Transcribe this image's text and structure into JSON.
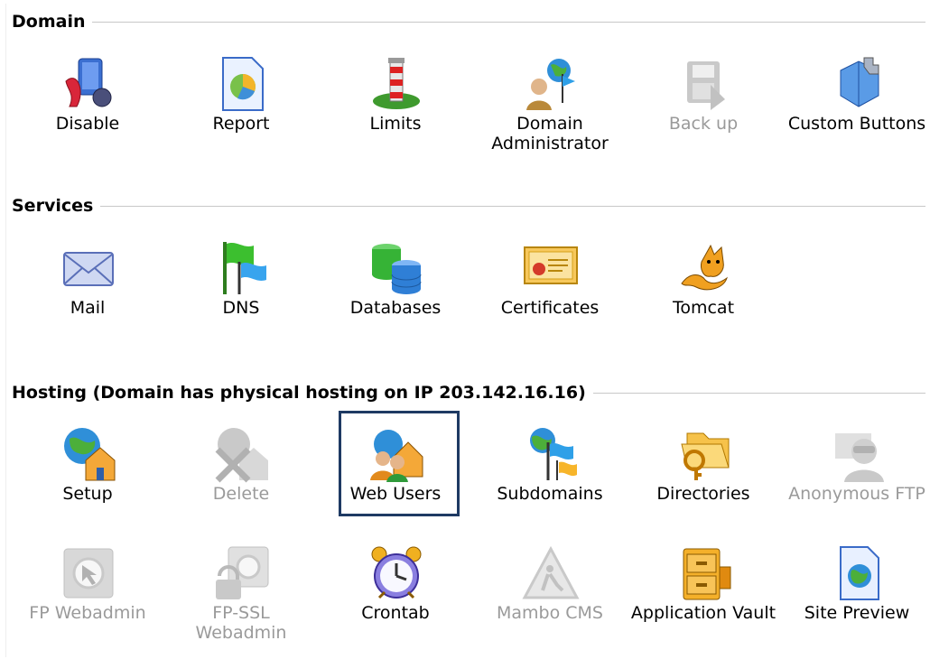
{
  "sections": {
    "domain": {
      "title": "Domain",
      "items": [
        {
          "label": "Disable",
          "icon": "disable-icon",
          "enabled": true
        },
        {
          "label": "Report",
          "icon": "report-icon",
          "enabled": true
        },
        {
          "label": "Limits",
          "icon": "limits-icon",
          "enabled": true
        },
        {
          "label": "Domain\nAdministrator",
          "icon": "domain-administrator-icon",
          "enabled": true
        },
        {
          "label": "Back up",
          "icon": "backup-icon",
          "enabled": false
        },
        {
          "label": "Custom Buttons",
          "icon": "custom-buttons-icon",
          "enabled": true
        }
      ]
    },
    "services": {
      "title": "Services",
      "items": [
        {
          "label": "Mail",
          "icon": "mail-icon",
          "enabled": true
        },
        {
          "label": "DNS",
          "icon": "dns-icon",
          "enabled": true
        },
        {
          "label": "Databases",
          "icon": "databases-icon",
          "enabled": true
        },
        {
          "label": "Certificates",
          "icon": "certificates-icon",
          "enabled": true
        },
        {
          "label": "Tomcat",
          "icon": "tomcat-icon",
          "enabled": true
        }
      ]
    },
    "hosting": {
      "title": "Hosting (Domain has physical hosting on IP 203.142.16.16)",
      "items": [
        {
          "label": "Setup",
          "icon": "setup-icon",
          "enabled": true
        },
        {
          "label": "Delete",
          "icon": "delete-icon",
          "enabled": false
        },
        {
          "label": "Web Users",
          "icon": "web-users-icon",
          "enabled": true,
          "selected": true
        },
        {
          "label": "Subdomains",
          "icon": "subdomains-icon",
          "enabled": true
        },
        {
          "label": "Directories",
          "icon": "directories-icon",
          "enabled": true
        },
        {
          "label": "Anonymous FTP",
          "icon": "anonymous-ftp-icon",
          "enabled": false
        },
        {
          "label": "FP Webadmin",
          "icon": "fp-webadmin-icon",
          "enabled": false
        },
        {
          "label": "FP-SSL\nWebadmin",
          "icon": "fp-ssl-webadmin-icon",
          "enabled": false
        },
        {
          "label": "Crontab",
          "icon": "crontab-icon",
          "enabled": true
        },
        {
          "label": "Mambo CMS",
          "icon": "mambo-cms-icon",
          "enabled": false
        },
        {
          "label": "Application Vault",
          "icon": "application-vault-icon",
          "enabled": true
        },
        {
          "label": "Site Preview",
          "icon": "site-preview-icon",
          "enabled": true
        }
      ]
    }
  },
  "colors": {
    "selection_border": "#1e3a63",
    "disabled_text": "#9a9a9a",
    "section_rule": "#c8c8c8"
  }
}
